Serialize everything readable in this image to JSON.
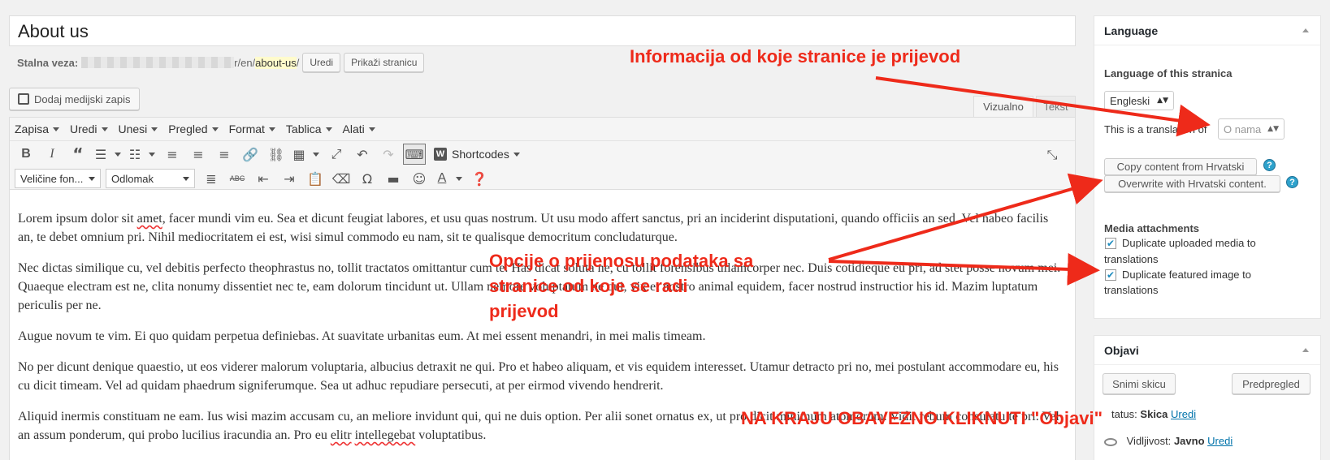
{
  "post": {
    "title": "About us",
    "permalink_label": "Stalna veza:",
    "permalink_path": "r/en/",
    "permalink_slug": "about-us",
    "permalink_end": "/",
    "edit_btn": "Uredi",
    "view_btn": "Prikaži stranicu"
  },
  "media_btn": "Dodaj medijski zapis",
  "editor_tabs": {
    "visual": "Vizualno",
    "text": "Tekst"
  },
  "menubar": [
    "Zapisa",
    "Uredi",
    "Unesi",
    "Pregled",
    "Format",
    "Tablica",
    "Alati"
  ],
  "toolbar": {
    "shortcodes": "Shortcodes",
    "font_size_select": "Veličine fon...",
    "format_select": "Odlomak"
  },
  "content": {
    "p1_a": "Lorem ipsum dolor sit ",
    "p1_sq": "amet",
    "p1_b": ", facer mundi vim eu. Sea et dicunt feugiat labores, et usu quas nostrum. Ut usu modo affert sanctus, pri an inciderint disputationi, quando officiis an sed. Vel habeo facilis an, te debet omnium pri. Nihil mediocritatem ei est, wisi simul commodo eu nam, sit te qualisque democritum concludaturque.",
    "p2": "Nec dictas similique cu, vel debitis perfecto theophrastus no, tollit tractatos omittantur cum te. Has dicat soluta ne, cu tollit forensibus ullamcorper nec. Duis cotidieque eu pri, ad stet posse novum mei. Quaeque electram est ne, clita nonumy dissentiet nec te, eam dolorum tincidunt ut. Ullam nemore voluptatum ne qui, vix et nostro animal equidem, facer nostrud instructior his id. Mazim luptatum periculis per ne.",
    "p3": "Augue novum te vim. Ei quo quidam perpetua definiebas. At suavitate urbanitas eum. At mei essent menandri, in mei malis timeam.",
    "p4": "No per dicunt denique quaestio, ut eos viderer malorum voluptaria, albucius detraxit ne qui. Pro et habeo aliquam, et vis equidem interesset. Utamur detracto pri no, mei postulant accommodare eu, his cu dicit timeam. Vel ad quidam phaedrum signiferumque. Sea ut adhuc repudiare persecuti, at per eirmod vivendo hendrerit.",
    "p5_a": "Aliquid inermis constituam ne eam. Ius wisi mazim accusam cu, an meliore invidunt qui, qui ne duis option. Per alii sonet ornatus ex, ut pro dicit minimum atomorum. Vidit rebum consulatu te pri. Vel an assum ponderum, qui probo lucilius iracundia an. Pro eu ",
    "p5_sq1": "elitr",
    "p5_sp": " ",
    "p5_sq2": "intellegebat",
    "p5_b": " voluptatibus."
  },
  "language_box": {
    "title": "Language",
    "lang_of_label": "Language of this stranica",
    "lang_value": "Engleski",
    "translation_label": "This is a translation of",
    "translation_placeholder": "O nama",
    "copy_btn": "Copy content from Hrvatski",
    "overwrite_btn": "Overwrite with Hrvatski content.",
    "media_label": "Media attachments",
    "dup_media_1": "Duplicate uploaded media to",
    "dup_media_2": "translations",
    "dup_feat_1": "Duplicate featured image to",
    "dup_feat_2": "translations"
  },
  "publish_box": {
    "title": "Objavi",
    "save_draft": "Snimi skicu",
    "preview": "Predpregled",
    "status_label": "tatus:",
    "status_value": "Skica",
    "status_edit": "Uredi",
    "visibility_label": "Vidljivost:",
    "visibility_value": "Javno",
    "visibility_edit": "Uredi"
  },
  "annotations": {
    "a1": "Informacija od koje stranice je prijevod",
    "a2_1": "Opcije o prijenosu podataka sa",
    "a2_2": "stranice od koje se radi",
    "a2_3": "prijevod",
    "a3": "NA KRAJU OBAVEZNO KLIKNUTI \"Objavi\""
  },
  "colors": {
    "annotation": "#ee2a1a",
    "link": "#0073aa"
  }
}
